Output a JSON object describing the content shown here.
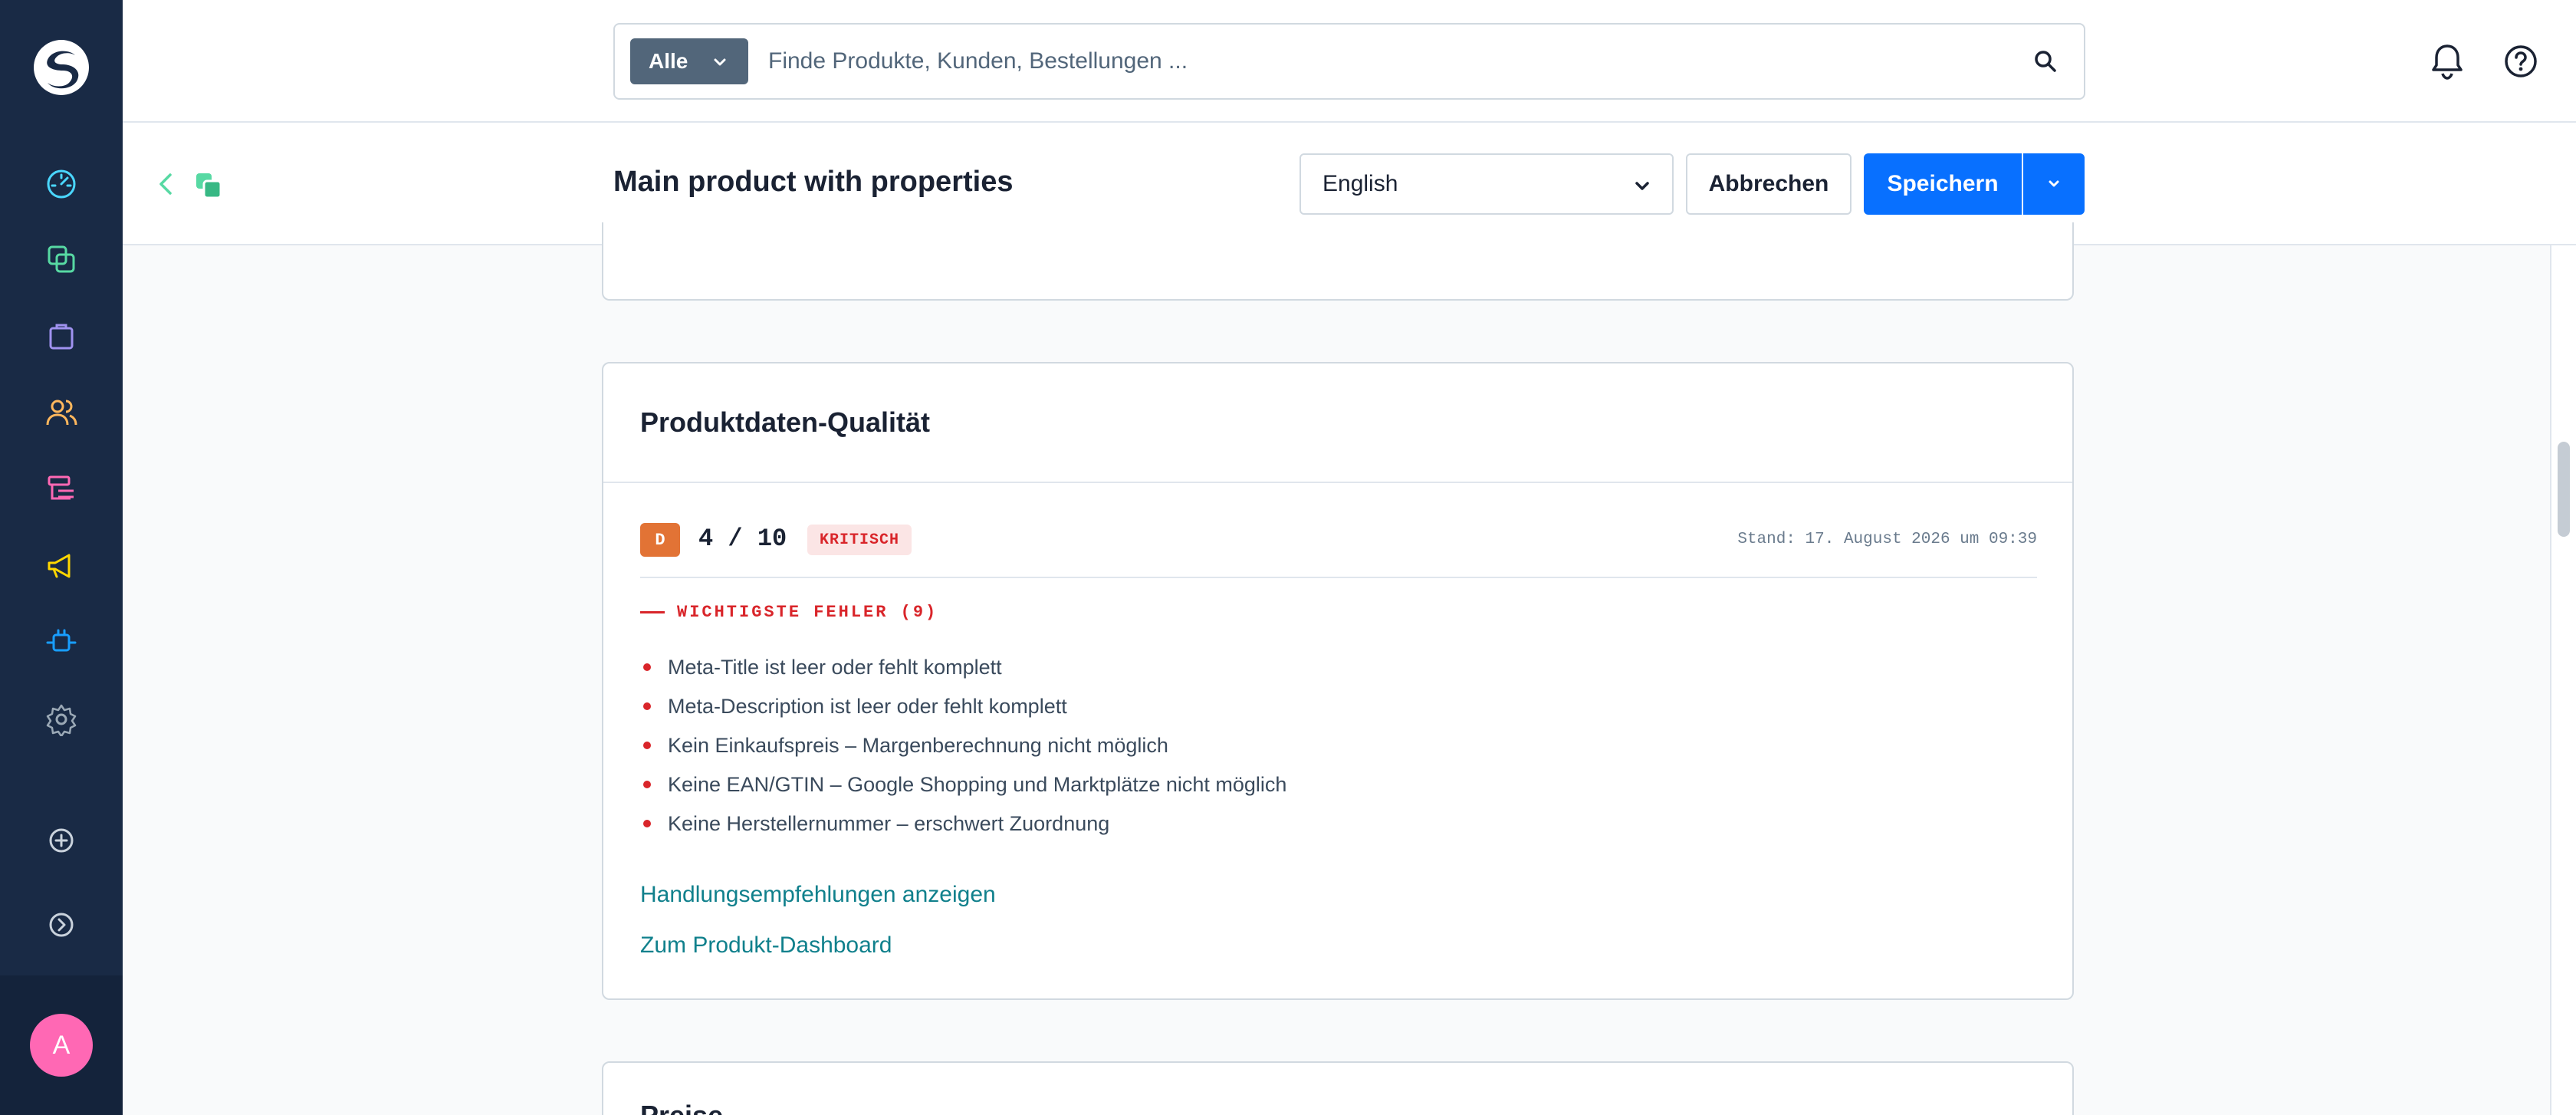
{
  "colors": {
    "sidebar": "#192a45",
    "primary": "#0870ff",
    "grade": "#e27335",
    "critical": "#d9252a",
    "link": "#10808c",
    "avatar": "#ff68b4"
  },
  "sidebar": {
    "items": [
      {
        "name": "dashboard",
        "icon": "gauge-icon",
        "color": "#4ad7ff"
      },
      {
        "name": "catalogues",
        "icon": "layers-icon",
        "color": "#57d9a3"
      },
      {
        "name": "orders",
        "icon": "shopping-bag-icon",
        "color": "#a092f0"
      },
      {
        "name": "customers",
        "icon": "users-icon",
        "color": "#ffb75d"
      },
      {
        "name": "content",
        "icon": "content-list-icon",
        "color": "#ff68b4"
      },
      {
        "name": "marketing",
        "icon": "megaphone-icon",
        "color": "#ffd700"
      },
      {
        "name": "extensions",
        "icon": "plugin-icon",
        "color": "#189eff"
      },
      {
        "name": "settings",
        "icon": "gear-icon",
        "color": "#9aa8b5"
      }
    ],
    "avatar_initial": "A"
  },
  "topbar": {
    "search_type": "Alle",
    "search_placeholder": "Finde Produkte, Kunden, Bestellungen ..."
  },
  "smartbar": {
    "title": "Main product with properties",
    "language": "English",
    "cancel_label": "Abbrechen",
    "save_label": "Speichern"
  },
  "quality": {
    "title": "Produktdaten-Qualität",
    "grade": "D",
    "score": "4 / 10",
    "status": "KRITISCH",
    "stand": "Stand: 17. August 2026 um 09:39",
    "errors_heading": "WICHTIGSTE FEHLER (9)",
    "errors": [
      "Meta-Title ist leer oder fehlt komplett",
      "Meta-Description ist leer oder fehlt komplett",
      "Kein Einkaufspreis – Margenberechnung nicht möglich",
      "Keine EAN/GTIN – Google Shopping und Marktplätze nicht möglich",
      "Keine Herstellernummer – erschwert Zuordnung"
    ],
    "link_recommendations": "Handlungsempfehlungen anzeigen",
    "link_dashboard": "Zum Produkt-Dashboard"
  },
  "next_card": {
    "title": "Preise"
  }
}
